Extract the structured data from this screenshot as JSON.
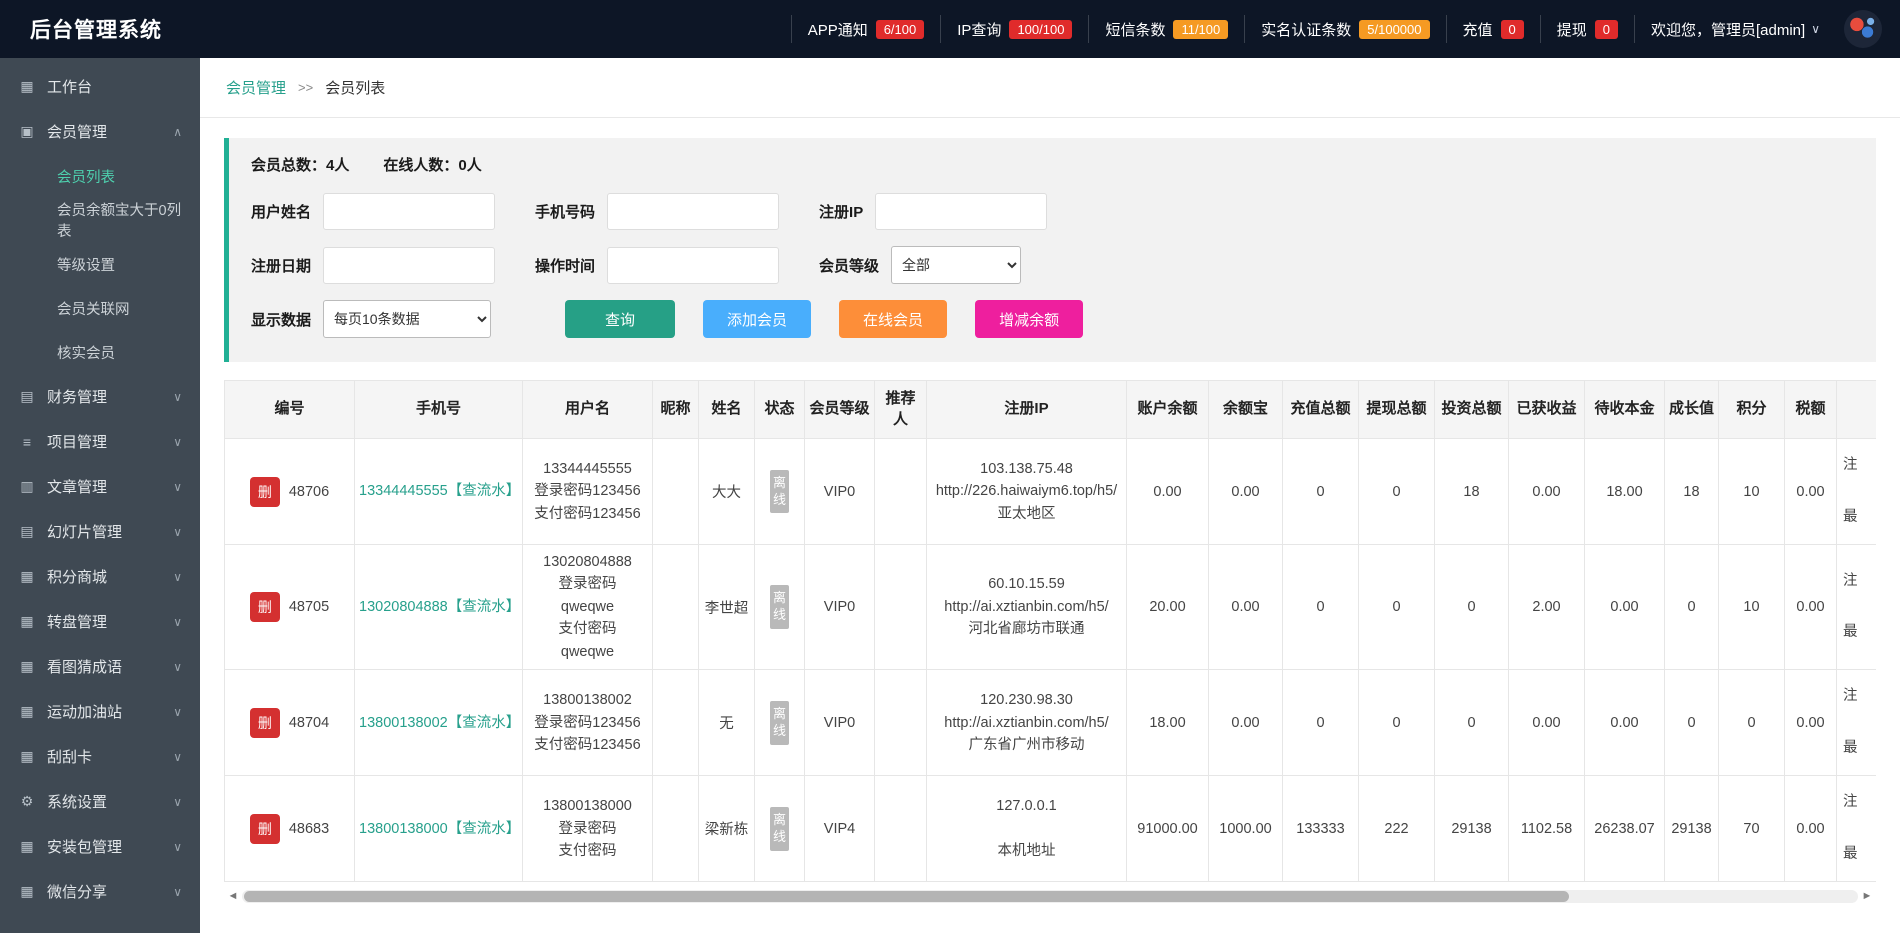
{
  "app": {
    "title": "后台管理系统"
  },
  "icons": {
    "caret_down": "∨",
    "chevron_down": "∨",
    "chevron_up": "∧",
    "workbench": "▦",
    "member": "▣",
    "scroll_left": "◄",
    "scroll_right": "►"
  },
  "topbar": {
    "items": [
      {
        "label": "APP通知",
        "badge": "6/100"
      },
      {
        "label": "IP查询",
        "badge": "100/100"
      },
      {
        "label": "短信条数",
        "badge": "11/100"
      },
      {
        "label": "实名认证条数",
        "badge": "5/100000"
      },
      {
        "label": "充值",
        "badge": "0"
      },
      {
        "label": "提现",
        "badge": "0"
      }
    ],
    "welcome": "欢迎您，管理员[admin]"
  },
  "sidebar": {
    "workbench": "工作台",
    "member_group": "会员管理",
    "member_sub": [
      "会员列表",
      "会员余额宝大于0列表",
      "等级设置",
      "会员关联网",
      "核实会员"
    ],
    "groups": [
      "财务管理",
      "项目管理",
      "文章管理",
      "幻灯片管理",
      "积分商城",
      "转盘管理",
      "看图猜成语",
      "运动加油站",
      "刮刮卡",
      "系统设置",
      "安装包管理",
      "微信分享"
    ],
    "group_icons": [
      "▤",
      "≡",
      "▥",
      "▤",
      "▦",
      "▦",
      "▦",
      "▦",
      "▦",
      "⚙",
      "▦",
      "▦"
    ]
  },
  "breadcrumb": {
    "section": "会员管理",
    "separator": ">>",
    "page": "会员列表"
  },
  "filters": {
    "stats": {
      "total_label": "会员总数：",
      "total_value": "4人",
      "online_label": "在线人数：",
      "online_value": "0人"
    },
    "username_label": "用户姓名",
    "phone_label": "手机号码",
    "reg_ip_label": "注册IP",
    "reg_date_label": "注册日期",
    "op_time_label": "操作时间",
    "level_label": "会员等级",
    "level_value": "全部",
    "page_size_label": "显示数据",
    "page_size_value": "每页10条数据",
    "buttons": {
      "query": "查询",
      "add": "添加会员",
      "online": "在线会员",
      "balance": "增减余额"
    }
  },
  "table": {
    "delete_label": "删",
    "headers": [
      "编号",
      "手机号",
      "用户名",
      "昵称",
      "姓名",
      "状态",
      "会员等级",
      "推荐人",
      "注册IP",
      "账户余额",
      "余额宝",
      "充值总额",
      "提现总额",
      "投资总额",
      "已获收益",
      "待收本金",
      "成长值",
      "积分",
      "税额"
    ],
    "rows": [
      {
        "id": "48706",
        "phone": "13344445555【查流水】",
        "user": "13344445555\n登录密码123456\n支付密码123456",
        "nickname": "",
        "name": "大大",
        "status": "离线",
        "level": "VIP0",
        "referrer": "",
        "ip": "103.138.75.48\nhttp://226.haiwaiym6.top/h5/\n亚太地区",
        "balance": "0.00",
        "yuebao": "0.00",
        "recharge": "0",
        "withdraw": "0",
        "invest": "18",
        "earned": "0.00",
        "pending": "18.00",
        "growth": "18",
        "points": "10",
        "tax": "0.00",
        "cut_top": "注",
        "cut_bottom": "最"
      },
      {
        "id": "48705",
        "phone": "13020804888【查流水】",
        "user": "13020804888\n登录密码\nqweqwe\n支付密码\nqweqwe",
        "nickname": "",
        "name": "李世超",
        "status": "离线",
        "level": "VIP0",
        "referrer": "",
        "ip": "60.10.15.59\nhttp://ai.xztianbin.com/h5/\n河北省廊坊市联通",
        "balance": "20.00",
        "yuebao": "0.00",
        "recharge": "0",
        "withdraw": "0",
        "invest": "0",
        "earned": "2.00",
        "pending": "0.00",
        "growth": "0",
        "points": "10",
        "tax": "0.00",
        "cut_top": "注",
        "cut_bottom": "最"
      },
      {
        "id": "48704",
        "phone": "13800138002【查流水】",
        "user": "13800138002\n登录密码123456\n支付密码123456",
        "nickname": "",
        "name": "无",
        "status": "离线",
        "level": "VIP0",
        "referrer": "",
        "ip": "120.230.98.30\nhttp://ai.xztianbin.com/h5/\n广东省广州市移动",
        "balance": "18.00",
        "yuebao": "0.00",
        "recharge": "0",
        "withdraw": "0",
        "invest": "0",
        "earned": "0.00",
        "pending": "0.00",
        "growth": "0",
        "points": "0",
        "tax": "0.00",
        "cut_top": "注",
        "cut_bottom": "最"
      },
      {
        "id": "48683",
        "phone": "13800138000【查流水】",
        "user": "13800138000\n登录密码\n支付密码",
        "nickname": "",
        "name": "梁新栋",
        "status": "离线",
        "level": "VIP4",
        "referrer": "",
        "ip": "127.0.0.1\n\n本机地址",
        "balance": "91000.00",
        "yuebao": "1000.00",
        "recharge": "133333",
        "withdraw": "222",
        "invest": "29138",
        "earned": "1102.58",
        "pending": "26238.07",
        "growth": "29138",
        "points": "70",
        "tax": "0.00",
        "cut_top": "注",
        "cut_bottom": "最"
      }
    ]
  }
}
